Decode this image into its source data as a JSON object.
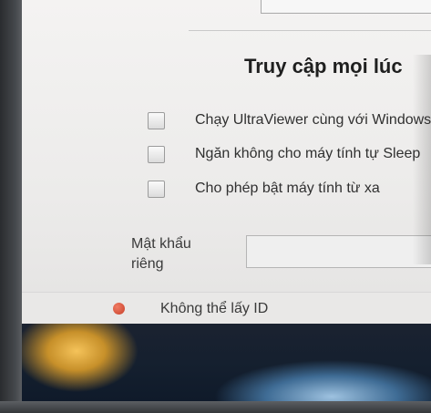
{
  "section_title": "Truy cập mọi lúc",
  "options": [
    {
      "label": "Chạy UltraViewer cùng với Windows",
      "checked": false
    },
    {
      "label": "Ngăn không cho máy tính tự Sleep",
      "checked": false
    },
    {
      "label": "Cho phép bật máy tính từ xa",
      "checked": false
    }
  ],
  "password": {
    "label_line1": "Mật khẩu",
    "label_line2": "riêng",
    "value": ""
  },
  "status": {
    "text": "Không thể lấy ID",
    "color": "#d9493a"
  }
}
